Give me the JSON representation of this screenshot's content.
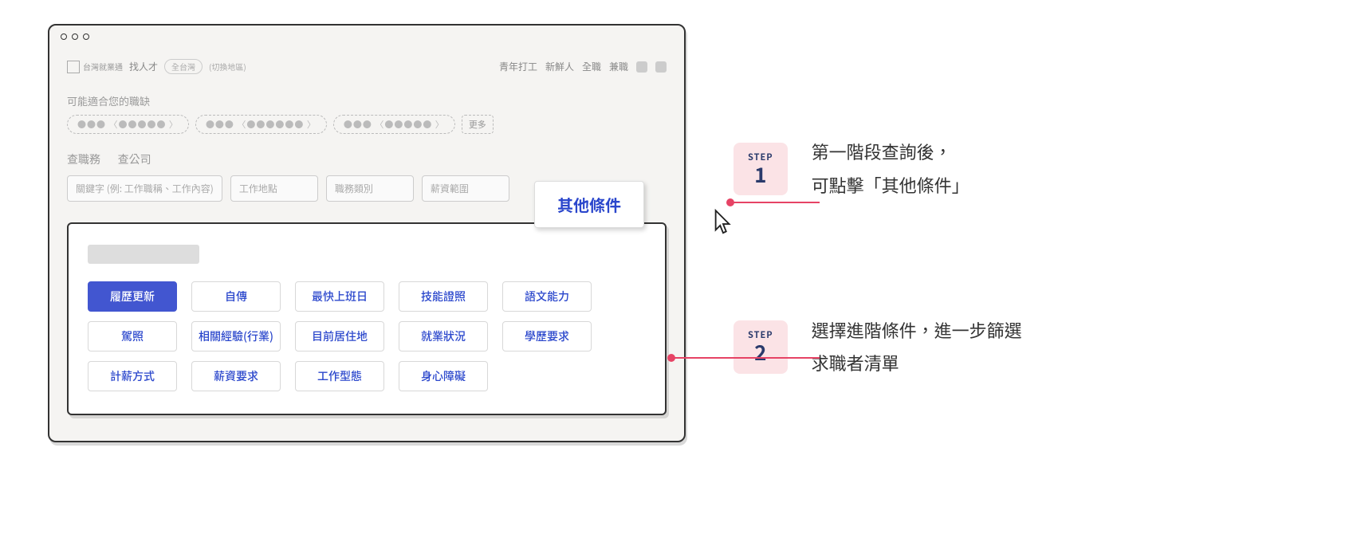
{
  "topbar": {
    "logo_text": "台灣就業通",
    "find_talent": "找人才",
    "region": "全台灣",
    "switch_region": "(切換地區)",
    "nav": [
      "青年打工",
      "新鮮人",
      "全職",
      "兼職"
    ]
  },
  "section_label": "可能適合您的職缺",
  "suggestion_pills": [
    "●●● 〈●●●●● 〉",
    "●●● 〈●●●●●● 〉",
    "●●● 〈●●●●● 〉"
  ],
  "more_label": "更多",
  "tabs": {
    "jobs": "查職務",
    "companies": "查公司"
  },
  "search": {
    "keyword_ph": "關鍵字 (例: 工作職稱、工作內容)",
    "location_ph": "工作地點",
    "category_ph": "職務類別",
    "salary_ph": "薪資範圍"
  },
  "popover": {
    "other_label": "其他條件"
  },
  "filter_chips": [
    {
      "label": "履歷更新",
      "active": true
    },
    {
      "label": "自傳",
      "active": false
    },
    {
      "label": "最快上班日",
      "active": false
    },
    {
      "label": "技能證照",
      "active": false
    },
    {
      "label": "語文能力",
      "active": false
    },
    {
      "label": "駕照",
      "active": false
    },
    {
      "label": "相關經驗(行業)",
      "active": false
    },
    {
      "label": "目前居住地",
      "active": false
    },
    {
      "label": "就業狀況",
      "active": false
    },
    {
      "label": "學歷要求",
      "active": false
    },
    {
      "label": "計薪方式",
      "active": false
    },
    {
      "label": "薪資要求",
      "active": false
    },
    {
      "label": "工作型態",
      "active": false
    },
    {
      "label": "身心障礙",
      "active": false
    }
  ],
  "steps": {
    "step_word": "STEP",
    "one": {
      "num": "1",
      "line1": "第一階段查詢後，",
      "line2": "可點擊「其他條件」"
    },
    "two": {
      "num": "2",
      "line1": "選擇進階條件，進一步篩選",
      "line2": "求職者清單"
    }
  }
}
